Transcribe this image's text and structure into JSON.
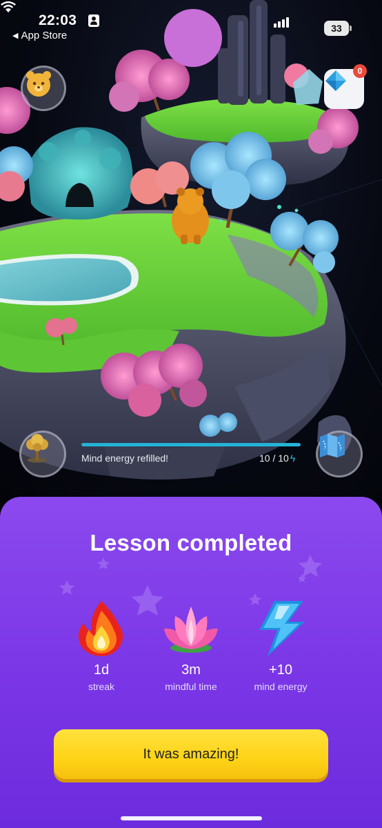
{
  "status_bar": {
    "time": "22:03",
    "back_app_label": "App Store",
    "battery_level": "33"
  },
  "scene": {
    "gem_badge_count": "0",
    "energy_status": "Mind energy refilled!",
    "energy_count": "10 / 10",
    "energy_fraction": 1.0
  },
  "lesson_panel": {
    "title": "Lesson completed",
    "stats": [
      {
        "value": "1d",
        "label": "streak",
        "icon": "fire-icon"
      },
      {
        "value": "3m",
        "label": "mindful time",
        "icon": "lotus-icon"
      },
      {
        "value": "+10",
        "label": "mind energy",
        "icon": "lightning-icon"
      }
    ],
    "cta_label": "It was amazing!"
  },
  "colors": {
    "panel_top": "#8b49ee",
    "panel_bottom": "#6c2bdd",
    "cta_yellow": "#fdd317",
    "energy_blue": "#23b3d6",
    "badge_red": "#ea4a3c",
    "grass_green": "#62d13a"
  }
}
